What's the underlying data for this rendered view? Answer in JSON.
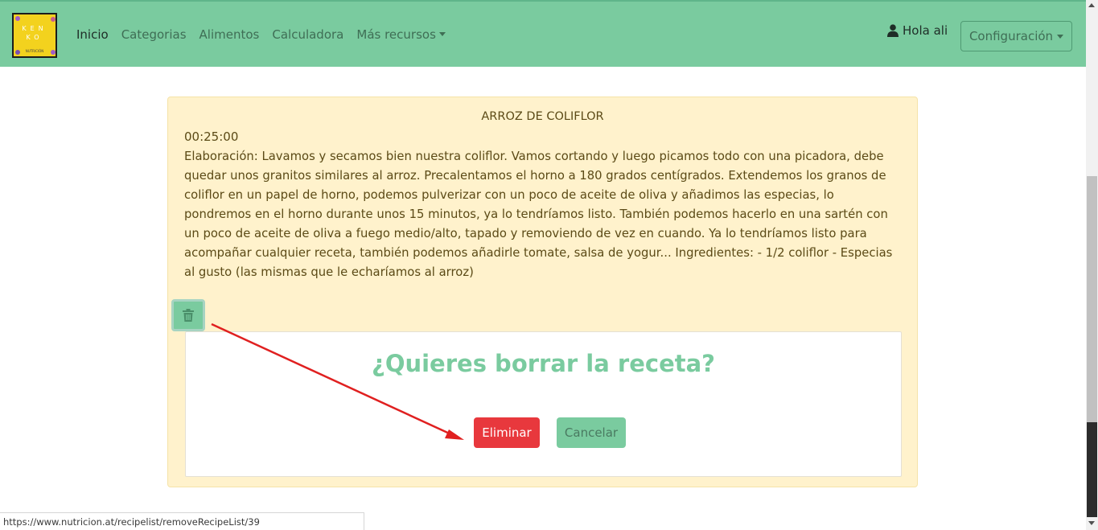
{
  "navbar": {
    "logo": {
      "line1": "KEN",
      "line2": "KO",
      "line3": "NUTRICIÓN"
    },
    "links": [
      "Inicio",
      "Categorias",
      "Alimentos",
      "Calculadora",
      "Más recursos"
    ],
    "user_label": "Hola ali",
    "config_label": "Configuración",
    "icons": {
      "user": "user-icon",
      "dropdown": "caret-down-icon"
    },
    "colors": {
      "background": "#7acb9f"
    }
  },
  "recipe": {
    "title": "ARROZ DE COLIFLOR",
    "time": "00:25:00",
    "description": "Elaboración: Lavamos y secamos bien nuestra coliflor. Vamos cortando y luego picamos todo con una picadora, debe quedar unos granitos similares al arroz. Precalentamos el horno a 180 grados centígrados. Extendemos los granos de coliflor en un papel de horno, podemos pulverizar con un poco de aceite de oliva y añadimos las especias, lo pondremos en el horno durante unos 15 minutos, ya lo tendríamos listo. También podemos hacerlo en una sartén con un poco de aceite de oliva a fuego medio/alto, tapado y removiendo de vez en cuando. Ya lo tendríamos listo para acompañar cualquier receta, también podemos añadirle tomate, salsa de yogur... Ingredientes: - 1/2 coliflor - Especias al gusto (las mismas que le echaríamos al arroz)",
    "trash_icon": "trash-icon",
    "colors": {
      "card_background": "#fff2cc"
    }
  },
  "dialog": {
    "question": "¿Quieres borrar la receta?",
    "delete_label": "Eliminar",
    "cancel_label": "Cancelar",
    "colors": {
      "delete": "#e8383d",
      "cancel": "#7acb9f",
      "question": "#7acb9f"
    }
  },
  "status_bar": {
    "url": "https://www.nutricion.at/recipelist/removeRecipeList/39"
  },
  "annotation": {
    "arrow_color": "#e02020"
  }
}
